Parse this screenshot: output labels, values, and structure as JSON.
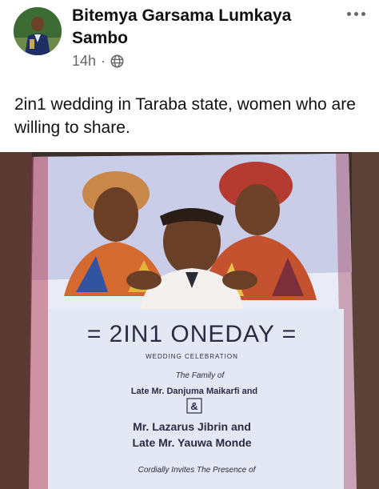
{
  "post": {
    "author": "Bitemya Garsama Lumkaya Sambo",
    "time": "14h",
    "separator": "·",
    "audience_icon": "globe-icon",
    "more_icon": "more-options-icon",
    "text": "2in1 wedding in Taraba state, women who are willing to share."
  },
  "poster": {
    "headline": "= 2IN1 ONEDAY =",
    "subtitle": "WEDDING CELEBRATION",
    "family_intro": "The Family of",
    "family_1": "Late Mr. Danjuma Maikarfi and",
    "ampersand": "&",
    "family_2": "Mr. Lazarus Jibrin and",
    "family_3": "Late Mr. Yauwa Monde",
    "invite": "Cordially Invites The Presence of"
  },
  "colors": {
    "author_text": "#111111",
    "meta_text": "#65676b",
    "poster_background": "#e9ecf7",
    "poster_text": "#2d2a44"
  }
}
